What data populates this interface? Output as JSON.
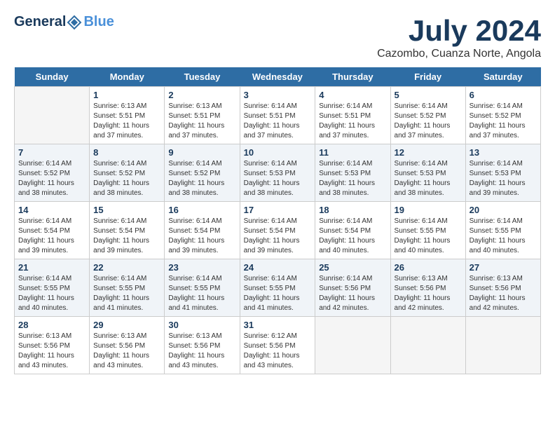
{
  "header": {
    "logo_line1": "General",
    "logo_line2": "Blue",
    "month_title": "July 2024",
    "location": "Cazombo, Cuanza Norte, Angola"
  },
  "days_of_week": [
    "Sunday",
    "Monday",
    "Tuesday",
    "Wednesday",
    "Thursday",
    "Friday",
    "Saturday"
  ],
  "weeks": [
    [
      {
        "day": "",
        "info": ""
      },
      {
        "day": "1",
        "info": "Sunrise: 6:13 AM\nSunset: 5:51 PM\nDaylight: 11 hours\nand 37 minutes."
      },
      {
        "day": "2",
        "info": "Sunrise: 6:13 AM\nSunset: 5:51 PM\nDaylight: 11 hours\nand 37 minutes."
      },
      {
        "day": "3",
        "info": "Sunrise: 6:14 AM\nSunset: 5:51 PM\nDaylight: 11 hours\nand 37 minutes."
      },
      {
        "day": "4",
        "info": "Sunrise: 6:14 AM\nSunset: 5:51 PM\nDaylight: 11 hours\nand 37 minutes."
      },
      {
        "day": "5",
        "info": "Sunrise: 6:14 AM\nSunset: 5:52 PM\nDaylight: 11 hours\nand 37 minutes."
      },
      {
        "day": "6",
        "info": "Sunrise: 6:14 AM\nSunset: 5:52 PM\nDaylight: 11 hours\nand 37 minutes."
      }
    ],
    [
      {
        "day": "7",
        "info": "Sunrise: 6:14 AM\nSunset: 5:52 PM\nDaylight: 11 hours\nand 38 minutes."
      },
      {
        "day": "8",
        "info": "Sunrise: 6:14 AM\nSunset: 5:52 PM\nDaylight: 11 hours\nand 38 minutes."
      },
      {
        "day": "9",
        "info": "Sunrise: 6:14 AM\nSunset: 5:52 PM\nDaylight: 11 hours\nand 38 minutes."
      },
      {
        "day": "10",
        "info": "Sunrise: 6:14 AM\nSunset: 5:53 PM\nDaylight: 11 hours\nand 38 minutes."
      },
      {
        "day": "11",
        "info": "Sunrise: 6:14 AM\nSunset: 5:53 PM\nDaylight: 11 hours\nand 38 minutes."
      },
      {
        "day": "12",
        "info": "Sunrise: 6:14 AM\nSunset: 5:53 PM\nDaylight: 11 hours\nand 38 minutes."
      },
      {
        "day": "13",
        "info": "Sunrise: 6:14 AM\nSunset: 5:53 PM\nDaylight: 11 hours\nand 39 minutes."
      }
    ],
    [
      {
        "day": "14",
        "info": "Sunrise: 6:14 AM\nSunset: 5:54 PM\nDaylight: 11 hours\nand 39 minutes."
      },
      {
        "day": "15",
        "info": "Sunrise: 6:14 AM\nSunset: 5:54 PM\nDaylight: 11 hours\nand 39 minutes."
      },
      {
        "day": "16",
        "info": "Sunrise: 6:14 AM\nSunset: 5:54 PM\nDaylight: 11 hours\nand 39 minutes."
      },
      {
        "day": "17",
        "info": "Sunrise: 6:14 AM\nSunset: 5:54 PM\nDaylight: 11 hours\nand 39 minutes."
      },
      {
        "day": "18",
        "info": "Sunrise: 6:14 AM\nSunset: 5:54 PM\nDaylight: 11 hours\nand 40 minutes."
      },
      {
        "day": "19",
        "info": "Sunrise: 6:14 AM\nSunset: 5:55 PM\nDaylight: 11 hours\nand 40 minutes."
      },
      {
        "day": "20",
        "info": "Sunrise: 6:14 AM\nSunset: 5:55 PM\nDaylight: 11 hours\nand 40 minutes."
      }
    ],
    [
      {
        "day": "21",
        "info": "Sunrise: 6:14 AM\nSunset: 5:55 PM\nDaylight: 11 hours\nand 40 minutes."
      },
      {
        "day": "22",
        "info": "Sunrise: 6:14 AM\nSunset: 5:55 PM\nDaylight: 11 hours\nand 41 minutes."
      },
      {
        "day": "23",
        "info": "Sunrise: 6:14 AM\nSunset: 5:55 PM\nDaylight: 11 hours\nand 41 minutes."
      },
      {
        "day": "24",
        "info": "Sunrise: 6:14 AM\nSunset: 5:55 PM\nDaylight: 11 hours\nand 41 minutes."
      },
      {
        "day": "25",
        "info": "Sunrise: 6:14 AM\nSunset: 5:56 PM\nDaylight: 11 hours\nand 42 minutes."
      },
      {
        "day": "26",
        "info": "Sunrise: 6:13 AM\nSunset: 5:56 PM\nDaylight: 11 hours\nand 42 minutes."
      },
      {
        "day": "27",
        "info": "Sunrise: 6:13 AM\nSunset: 5:56 PM\nDaylight: 11 hours\nand 42 minutes."
      }
    ],
    [
      {
        "day": "28",
        "info": "Sunrise: 6:13 AM\nSunset: 5:56 PM\nDaylight: 11 hours\nand 43 minutes."
      },
      {
        "day": "29",
        "info": "Sunrise: 6:13 AM\nSunset: 5:56 PM\nDaylight: 11 hours\nand 43 minutes."
      },
      {
        "day": "30",
        "info": "Sunrise: 6:13 AM\nSunset: 5:56 PM\nDaylight: 11 hours\nand 43 minutes."
      },
      {
        "day": "31",
        "info": "Sunrise: 6:12 AM\nSunset: 5:56 PM\nDaylight: 11 hours\nand 43 minutes."
      },
      {
        "day": "",
        "info": ""
      },
      {
        "day": "",
        "info": ""
      },
      {
        "day": "",
        "info": ""
      }
    ]
  ]
}
